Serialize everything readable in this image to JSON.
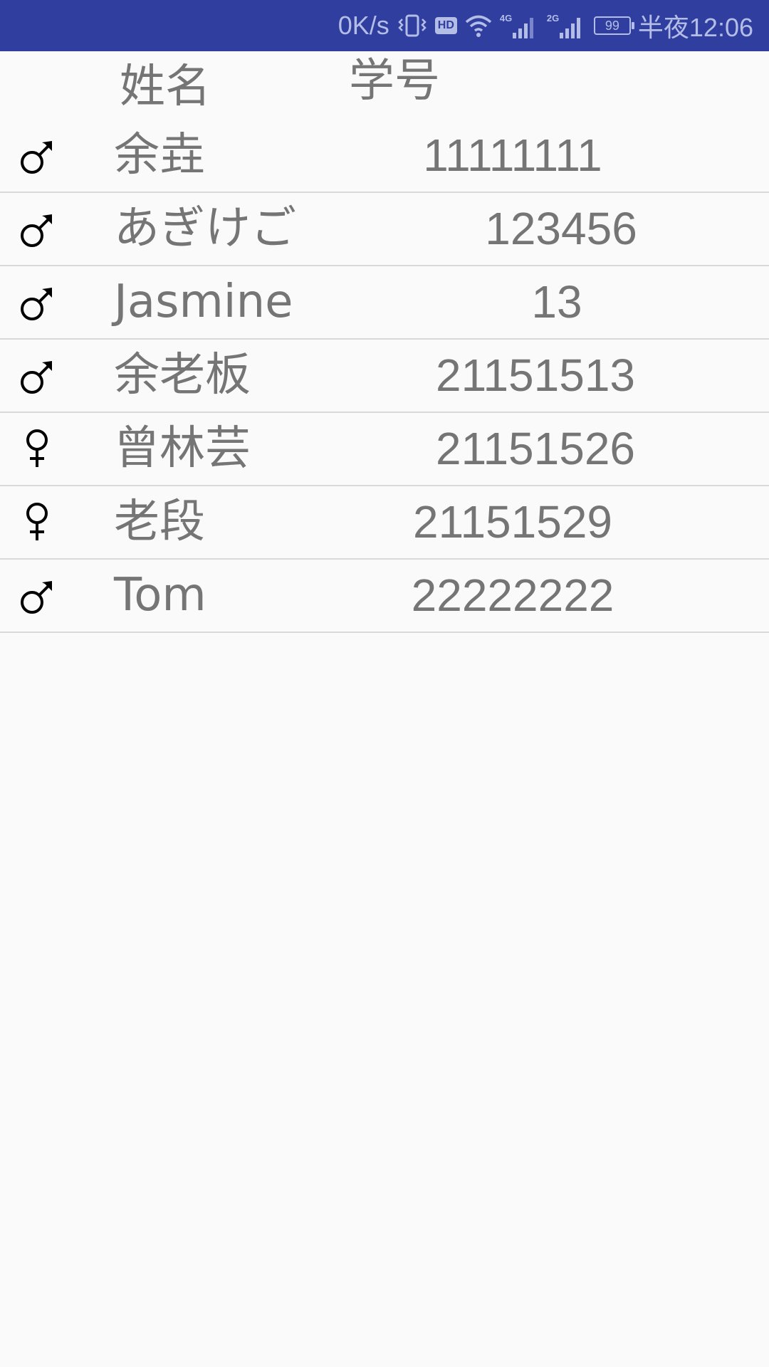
{
  "status_bar": {
    "speed": "0K/s",
    "vibrate_icon": "vibrate-icon",
    "hd_badge": "HD",
    "wifi_icon": "wifi-icon",
    "network_1": "4G",
    "network_2": "2G",
    "battery_level": "99",
    "time": "半夜12:06",
    "background_color": "#303f9f"
  },
  "table": {
    "headers": {
      "name": "姓名",
      "student_id": "学号"
    },
    "rows": [
      {
        "gender": "male",
        "name": "余垚",
        "student_id": "11111111"
      },
      {
        "gender": "male",
        "name": "あぎけご",
        "student_id": "123456"
      },
      {
        "gender": "male",
        "name": "Jasmine",
        "student_id": "13"
      },
      {
        "gender": "male",
        "name": "余老板",
        "student_id": "21151513"
      },
      {
        "gender": "female",
        "name": "曾林芸",
        "student_id": "21151526"
      },
      {
        "gender": "female",
        "name": "老段",
        "student_id": "21151529"
      },
      {
        "gender": "male",
        "name": "Tom",
        "student_id": "22222222"
      }
    ]
  }
}
